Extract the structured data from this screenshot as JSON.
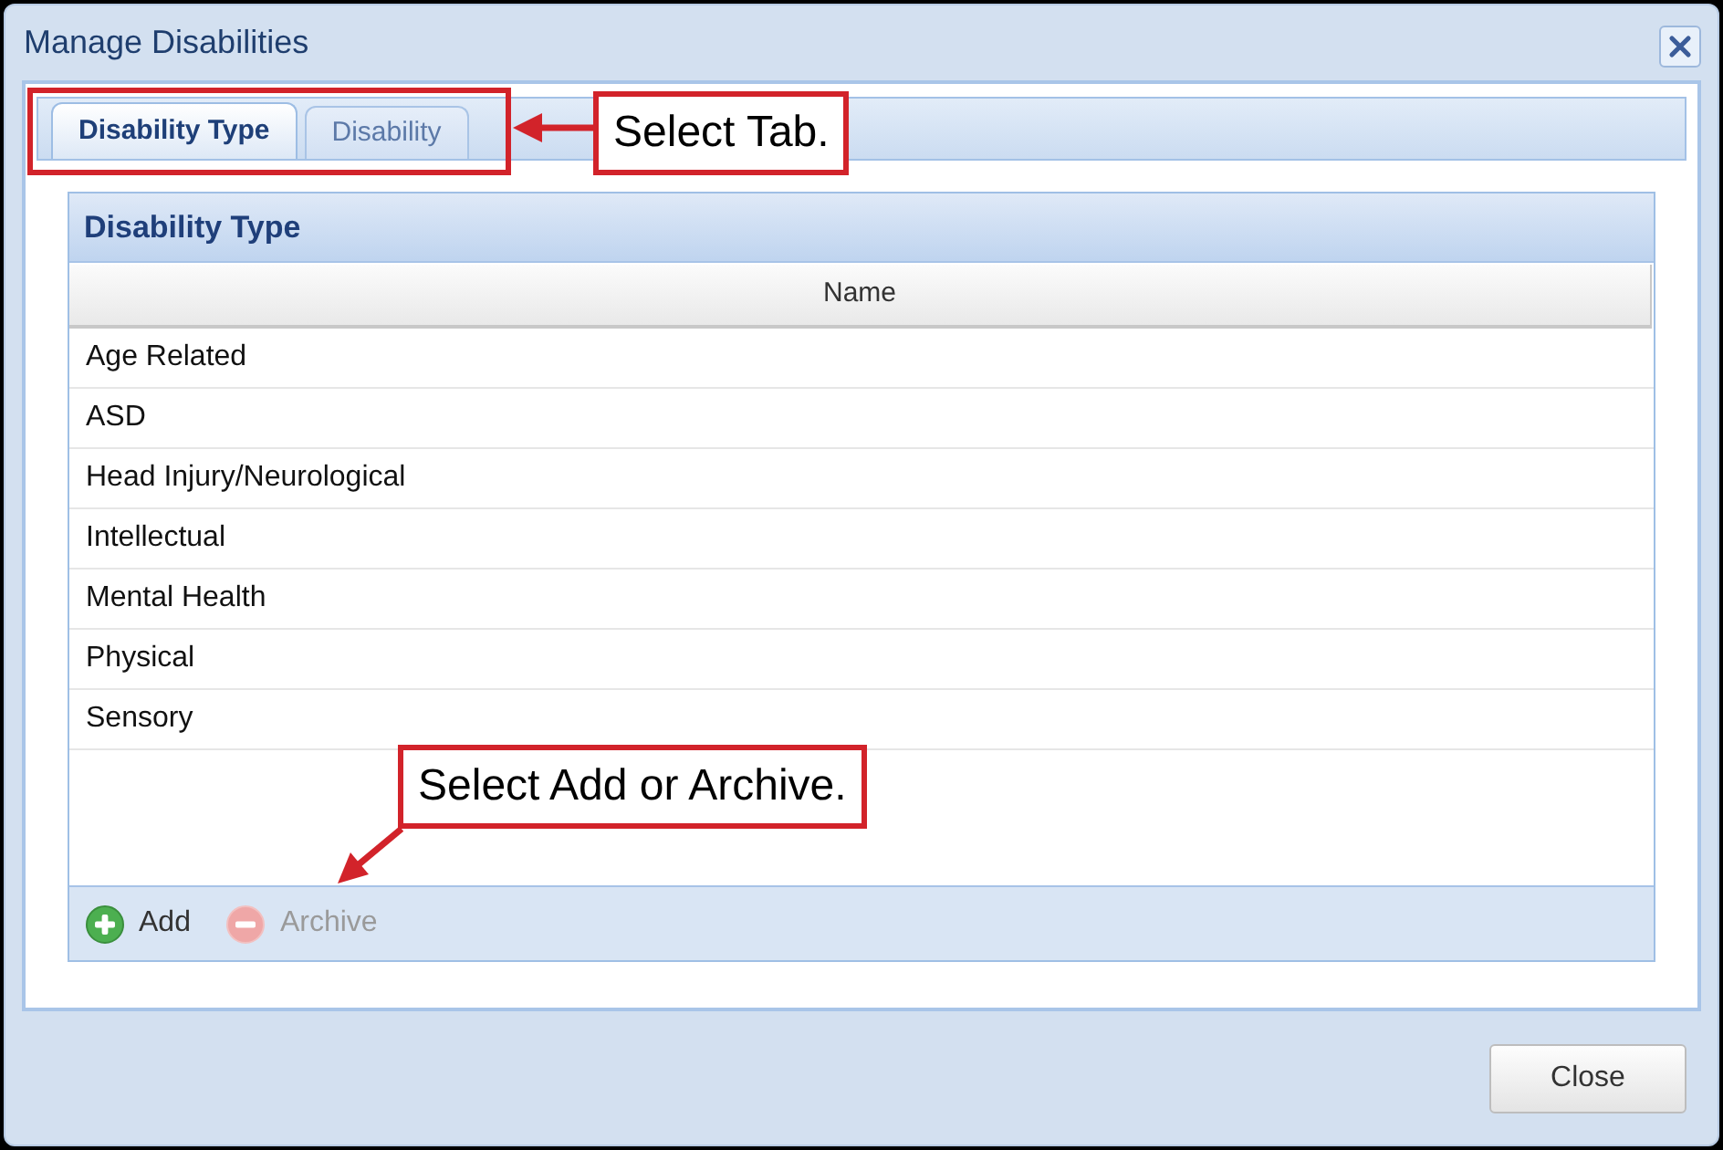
{
  "window": {
    "title": "Manage Disabilities"
  },
  "tabs": [
    {
      "label": "Disability Type",
      "selected": true
    },
    {
      "label": "Disability",
      "selected": false
    }
  ],
  "panel": {
    "title": "Disability Type"
  },
  "table": {
    "columns": [
      "Name"
    ],
    "rows": [
      "Age Related",
      "ASD",
      "Head Injury/Neurological",
      "Intellectual",
      "Mental Health",
      "Physical",
      "Sensory"
    ]
  },
  "toolbar": [
    {
      "label": "Add",
      "kind": "add",
      "disabled": false
    },
    {
      "label": "Archive",
      "kind": "archive",
      "disabled": true
    }
  ],
  "footer": {
    "buttons": [
      "Close"
    ]
  },
  "annotations": [
    {
      "kind": "tabs",
      "text": "Select Tab."
    },
    {
      "kind": "toolbar",
      "text": "Select Add or Archive."
    }
  ]
}
